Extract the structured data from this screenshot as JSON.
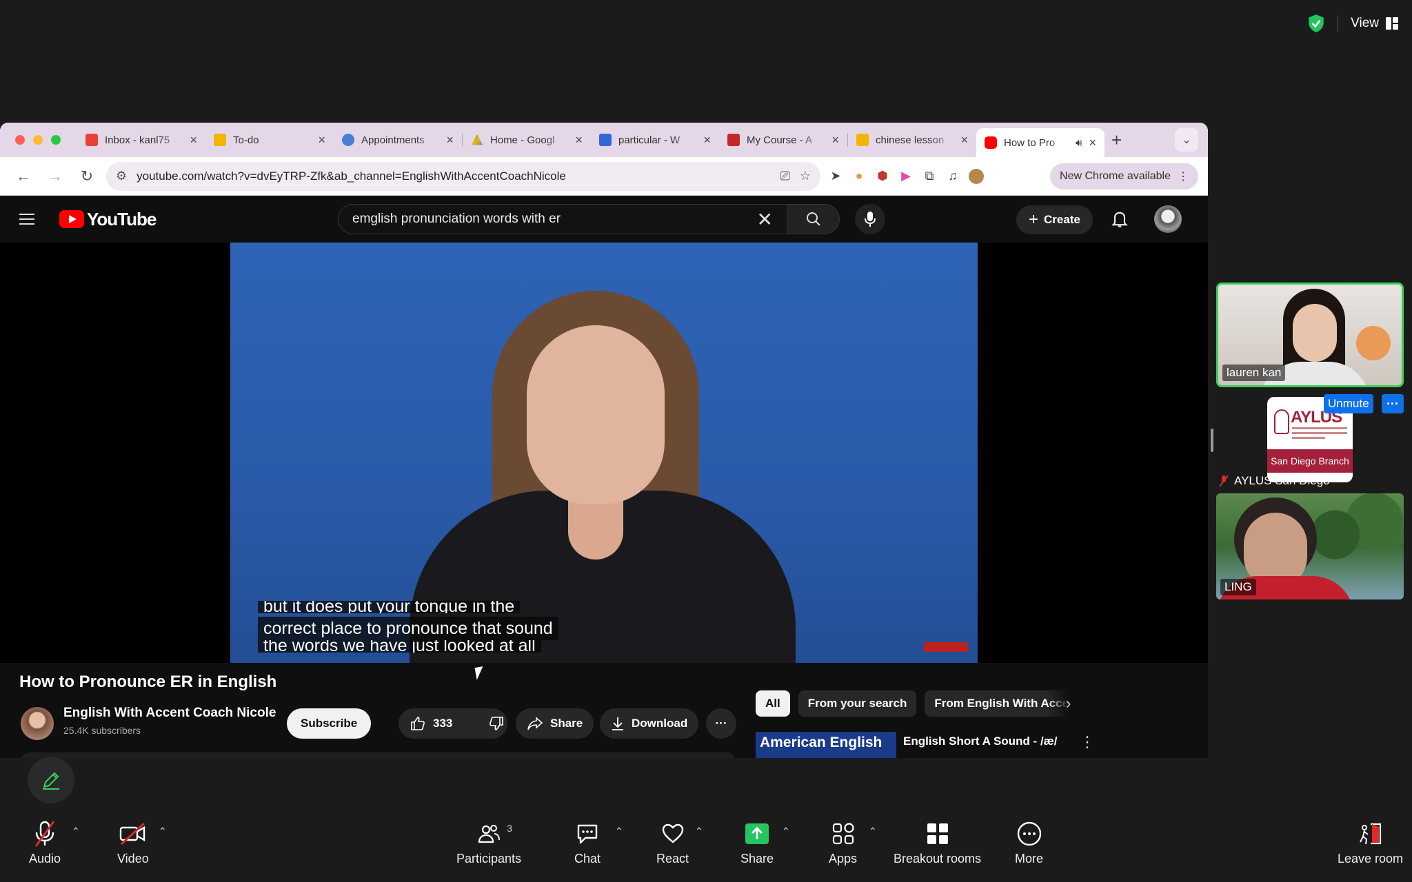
{
  "zoom": {
    "view_label": "View",
    "shield_color": "#22c55e"
  },
  "chrome": {
    "tabs": [
      {
        "title": "Inbox - kanl75",
        "favicon": "gmail-icon",
        "color": "#ea4335"
      },
      {
        "title": "To-do",
        "favicon": "todo-icon",
        "color": "#f4b400"
      },
      {
        "title": "Appointments",
        "favicon": "globe-icon",
        "color": "#4a7fd6"
      },
      {
        "title": "Home - Googl",
        "favicon": "drive-icon",
        "color": "#0f9d58"
      },
      {
        "title": "particular - W",
        "favicon": "wr-icon",
        "color": "#3367d6"
      },
      {
        "title": "My Course - A",
        "favicon": "course-icon",
        "color": "#c62828"
      },
      {
        "title": "chinese lesson",
        "favicon": "slides-icon",
        "color": "#f4b400"
      },
      {
        "title": "How to Pro",
        "favicon": "youtube-icon",
        "color": "#ff0000",
        "active": true
      }
    ],
    "url": "youtube.com/watch?v=dvEyTRP-Zfk&ab_channel=EnglishWithAccentCoachNicole",
    "new_chrome_label": "New Chrome available"
  },
  "youtube": {
    "logo_text": "YouTube",
    "search_query": "emglish pronunciation words with er",
    "create_label": "Create",
    "captions": [
      "but it does put your tongue in the",
      "correct place to pronounce that sound",
      "the words we have just looked at all"
    ],
    "video_title": "How to Pronounce ER in English",
    "channel_name": "English With Accent Coach Nicole",
    "channel_subs": "25.4K subscribers",
    "subscribe_label": "Subscribe",
    "like_count": "333",
    "share_label": "Share",
    "download_label": "Download",
    "chips": [
      "All",
      "From your search",
      "From English With Accent"
    ],
    "rec_thumb_text": "American English",
    "rec_title": "English Short A Sound - /æ/"
  },
  "participants": {
    "lauren": "lauren kan",
    "aylus": "AYLUS San Diego",
    "aylus_logo": "AYLUS",
    "aylus_band": "San Diego Branch",
    "ling": "LING",
    "unmute_label": "Unmute"
  },
  "toolbar": {
    "audio": "Audio",
    "video": "Video",
    "participants": "Participants",
    "participants_count": "3",
    "chat": "Chat",
    "react": "React",
    "share": "Share",
    "apps": "Apps",
    "breakout": "Breakout rooms",
    "more": "More",
    "leave": "Leave room"
  }
}
